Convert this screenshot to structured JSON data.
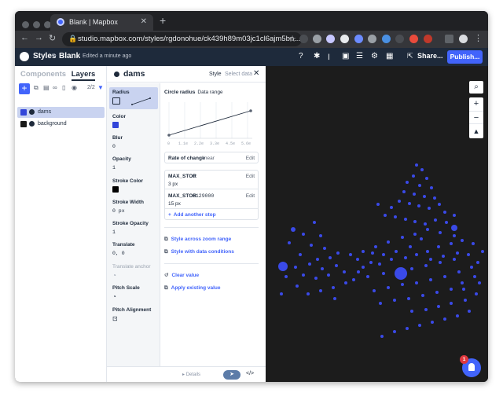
{
  "browser": {
    "tab_title": "Blank | Mapbox",
    "new_tab_glyph": "+",
    "url": "studio.mapbox.com/styles/rgdonohue/ck439h89m03jc1cl6ajm5bn..."
  },
  "header": {
    "styles_label": "Styles",
    "separator": ">",
    "style_name": "Blank",
    "edited": "Edited a minute ago",
    "share_label": "Share...",
    "publish_label": "Publish...",
    "brand_color": "#4264fb"
  },
  "layers_panel": {
    "tab_components": "Components",
    "tab_layers": "Layers",
    "count": "2/2",
    "items": [
      {
        "label": "dams",
        "swatch": "#3346d9",
        "selected": true
      },
      {
        "label": "background",
        "swatch": "#1a1a1a",
        "selected": false
      }
    ]
  },
  "properties": {
    "layer_name": "dams",
    "tab_style": "Style",
    "tab_select_data": "Select data",
    "list": [
      {
        "name": "Radius",
        "value": "",
        "selected": true
      },
      {
        "name": "Color",
        "value": "",
        "swatch": "#3346d9"
      },
      {
        "name": "Blur",
        "value": "0"
      },
      {
        "name": "Opacity",
        "value": "1"
      },
      {
        "name": "Stroke Color",
        "value": "",
        "swatch": "#000000"
      },
      {
        "name": "Stroke Width",
        "value": "0 px"
      },
      {
        "name": "Stroke Opacity",
        "value": "1"
      },
      {
        "name": "Translate",
        "value": "0, 0"
      },
      {
        "name": "Translate anchor",
        "value": "",
        "dim": true
      },
      {
        "name": "Pitch Scale",
        "value": ""
      },
      {
        "name": "Pitch Alignment",
        "value": ""
      }
    ]
  },
  "editor": {
    "title": "Circle radius",
    "subtitle": "Data range",
    "chart_ticks": [
      "0",
      "1.1e",
      "2.2e",
      "3.3e",
      "4.5e",
      "5.6e"
    ],
    "rate_label": "Rate of change",
    "rate_value": "linear",
    "edit_label": "Edit",
    "stops": [
      {
        "field": "MAX_STOR",
        "value": "0",
        "output": "3 px"
      },
      {
        "field": "MAX_STOR",
        "value": "6129000",
        "output": "15 px"
      }
    ],
    "add_stop": "Add another stop",
    "zoom_range": "Style across zoom range",
    "data_conditions": "Style with data conditions",
    "clear_value": "Clear value",
    "apply_existing": "Apply existing value",
    "details": "Details",
    "code_glyph": "</>"
  },
  "map": {
    "zoom_in": "+",
    "zoom_out": "−",
    "notification_count": "1",
    "point_color": "#3a4ae8"
  }
}
